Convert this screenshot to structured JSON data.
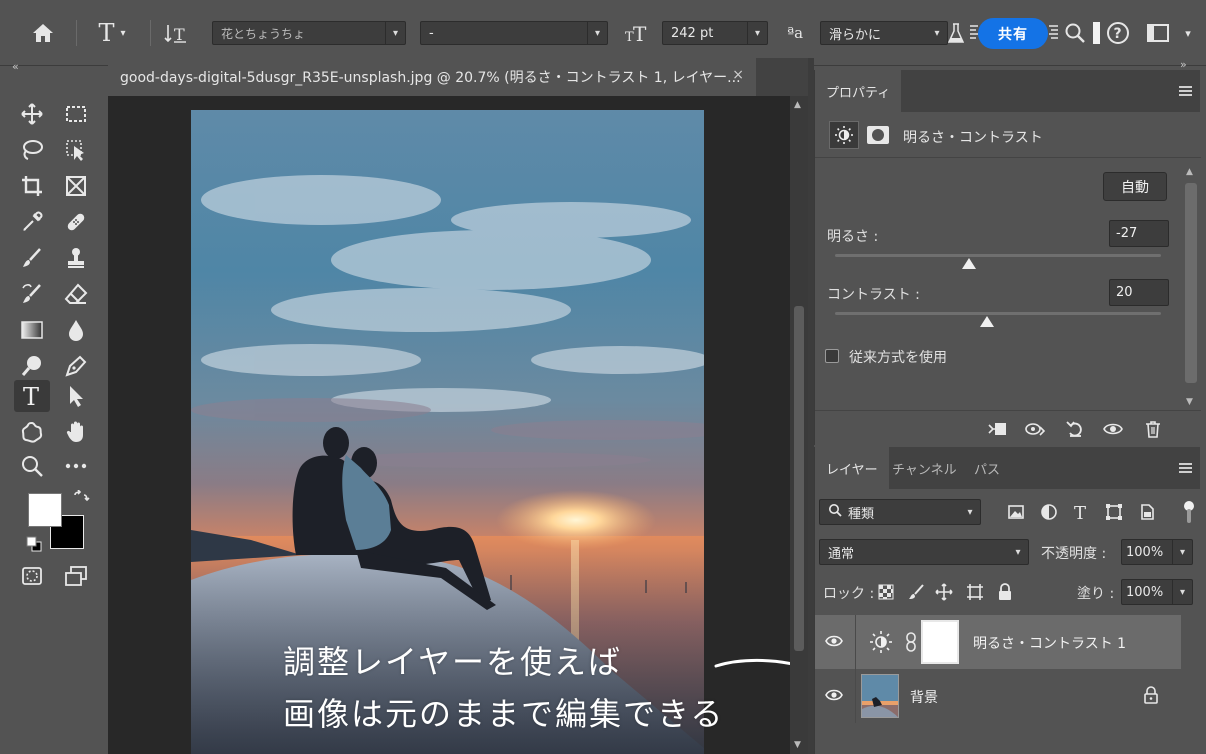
{
  "options_bar": {
    "font_family": "花とちょうちょ",
    "font_style": "-",
    "font_size": "242 pt",
    "aa_icon_label": "aa",
    "antialias": "滑らかに",
    "share_label": "共有"
  },
  "document": {
    "tab_title": "good-days-digital-5dusgr_R35E-unsplash.jpg @ 20.7% (明るさ・コントラスト 1, レイヤー...",
    "close_glyph": "×"
  },
  "caption": {
    "line1": "調整レイヤーを使えば",
    "line2": "画像は元のままで編集できる"
  },
  "properties": {
    "tab": "プロパティ",
    "title": "明るさ・コントラスト",
    "auto_button": "自動",
    "brightness_label": "明るさ :",
    "brightness_value": "-27",
    "brightness_level": -27,
    "contrast_label": "コントラスト :",
    "contrast_value": "20",
    "contrast_level": 20,
    "legacy_label": "従来方式を使用",
    "legacy_checked": false
  },
  "layers_panel": {
    "tabs": [
      "レイヤー",
      "チャンネル",
      "パス"
    ],
    "filter_label": "種類",
    "blend_mode": "通常",
    "opacity_label": "不透明度 :",
    "opacity_value": "100%",
    "lock_label": "ロック :",
    "fill_label": "塗り :",
    "fill_value": "100%",
    "layers": [
      {
        "name": "明るさ・コントラスト 1",
        "type": "adjustment",
        "visible": true,
        "selected": true
      },
      {
        "name": "背景",
        "type": "pixel",
        "visible": true,
        "selected": false,
        "locked": true
      }
    ]
  },
  "colors": {
    "accent": "#1473e6",
    "foreground": "#ffffff",
    "background": "#000000"
  }
}
